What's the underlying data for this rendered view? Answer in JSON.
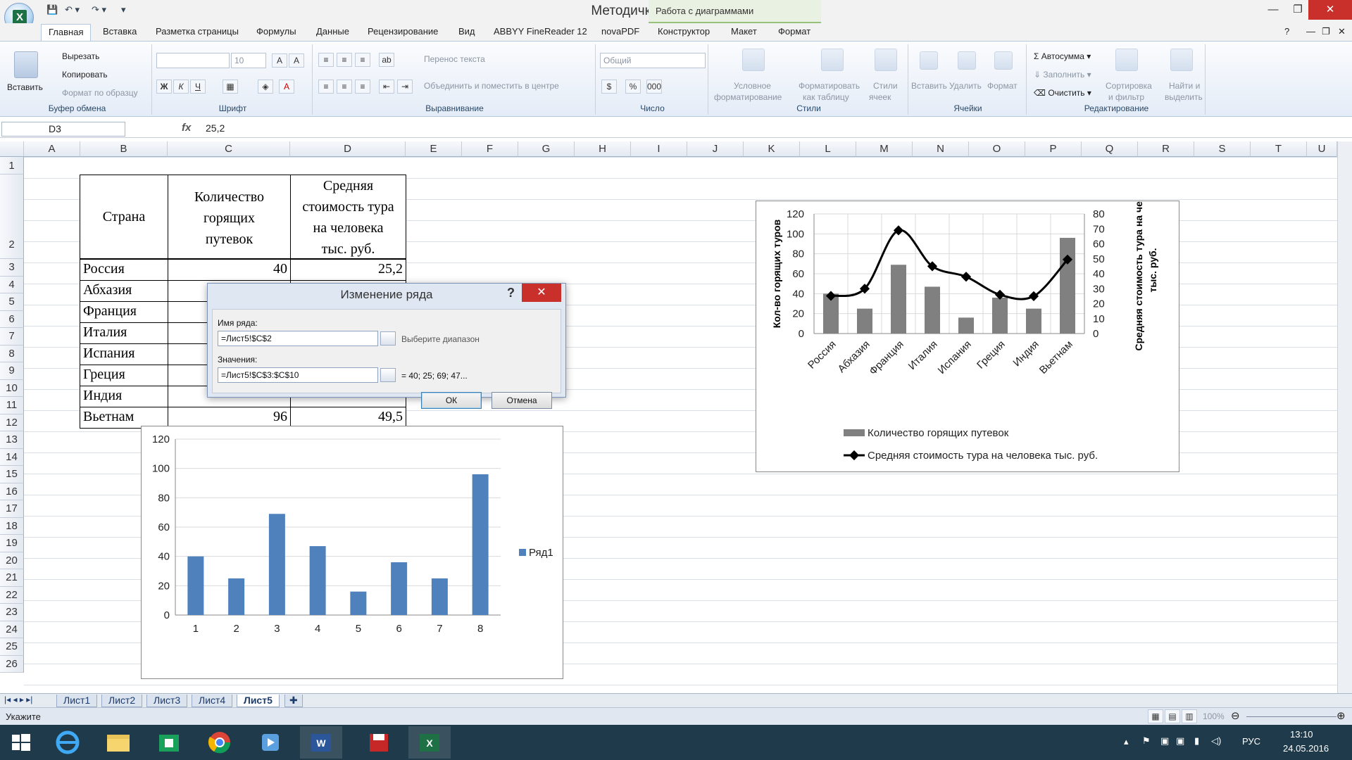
{
  "window": {
    "title": "Методичка - Microsoft Excel",
    "context_tab_group": "Работа с диаграммами"
  },
  "tabs": [
    {
      "label": "Главная",
      "active": true
    },
    {
      "label": "Вставка"
    },
    {
      "label": "Разметка страницы"
    },
    {
      "label": "Формулы"
    },
    {
      "label": "Данные"
    },
    {
      "label": "Рецензирование"
    },
    {
      "label": "Вид"
    },
    {
      "label": "ABBYY FineReader 12"
    },
    {
      "label": "novaPDF"
    },
    {
      "label": "Конструктор"
    },
    {
      "label": "Макет"
    },
    {
      "label": "Формат"
    }
  ],
  "ribbon": {
    "clipboard": {
      "paste": "Вставить",
      "cut": "Вырезать",
      "copy": "Копировать",
      "format_painter": "Формат по образцу",
      "label": "Буфер обмена"
    },
    "font": {
      "size": "10",
      "label": "Шрифт",
      "bold": "Ж",
      "italic": "К",
      "underline": "Ч"
    },
    "alignment": {
      "wrap": "Перенос текста",
      "merge": "Объединить и поместить в центре",
      "label": "Выравнивание"
    },
    "number": {
      "format": "Общий",
      "label": "Число"
    },
    "styles": {
      "conditional": "Условное",
      "conditional2": "форматирование",
      "as_table": "Форматировать",
      "as_table2": "как таблицу",
      "cell_styles": "Стили",
      "cell_styles2": "ячеек",
      "label": "Стили"
    },
    "cells": {
      "insert": "Вставить",
      "delete": "Удалить",
      "format": "Формат",
      "label": "Ячейки"
    },
    "editing": {
      "autosum": "Автосумма",
      "fill": "Заполнить",
      "clear": "Очистить",
      "sort": "Сортировка",
      "sort2": "и фильтр",
      "find": "Найти и",
      "find2": "выделить",
      "label": "Редактирование"
    }
  },
  "formula_bar": {
    "cell": "D3",
    "fx": "fx",
    "value": "25,2"
  },
  "columns": [
    "A",
    "B",
    "C",
    "D",
    "E",
    "F",
    "G",
    "H",
    "I",
    "J",
    "K",
    "L",
    "M",
    "N",
    "O",
    "P",
    "Q",
    "R",
    "S",
    "T",
    "U"
  ],
  "rows": [
    "1",
    "2",
    "3",
    "4",
    "5",
    "6",
    "7",
    "8",
    "9",
    "10",
    "11",
    "12",
    "13",
    "14",
    "15",
    "16",
    "17",
    "18",
    "19",
    "20",
    "21",
    "22",
    "23",
    "24",
    "25",
    "26"
  ],
  "table": {
    "header_country": "Страна",
    "header_count": [
      "Количество",
      "горящих",
      "путевок"
    ],
    "header_cost": [
      "Средняя",
      "стоимость тура",
      "на человека",
      "тыс. руб."
    ],
    "rows": [
      {
        "country": "Россия",
        "count": "40",
        "cost": "25,2"
      },
      {
        "country": "Абхазия",
        "count": "",
        "cost": ""
      },
      {
        "country": "Франция",
        "count": "",
        "cost": ""
      },
      {
        "country": "Италия",
        "count": "",
        "cost": ""
      },
      {
        "country": "Испания",
        "count": "",
        "cost": ""
      },
      {
        "country": "Греция",
        "count": "",
        "cost": ""
      },
      {
        "country": "Индия",
        "count": "",
        "cost": ""
      },
      {
        "country": "Вьетнам",
        "count": "96",
        "cost": "49,5"
      }
    ]
  },
  "dialog": {
    "title": "Изменение ряда",
    "help": "?",
    "close": "✕",
    "name_label": "Имя ряда:",
    "name_value": "=Лист5!$C$2",
    "name_hint": "Выберите диапазон",
    "values_label": "Значения:",
    "values_value": "=Лист5!$C$3:$C$10",
    "values_hint": "= 40; 25; 69; 47...",
    "ok": "ОК",
    "cancel": "Отмена"
  },
  "chart_data": [
    {
      "type": "bar",
      "categories": [
        "1",
        "2",
        "3",
        "4",
        "5",
        "6",
        "7",
        "8"
      ],
      "series": [
        {
          "name": "Ряд1",
          "values": [
            40,
            25,
            69,
            47,
            16,
            36,
            25,
            96
          ],
          "color": "#4f81bd"
        }
      ],
      "ylim": [
        0,
        120
      ],
      "yticks": [
        "0",
        "20",
        "40",
        "60",
        "80",
        "100",
        "120"
      ],
      "legend": "right"
    },
    {
      "type": "bar",
      "categories": [
        "Россия",
        "Абхазия",
        "Франция",
        "Италия",
        "Испания",
        "Греция",
        "Индия",
        "Вьетнам"
      ],
      "series": [
        {
          "name": "Количество горящих путевок",
          "values": [
            40,
            25,
            69,
            47,
            16,
            36,
            25,
            96
          ],
          "color": "#808080",
          "axis": "left"
        },
        {
          "name": "Средняя стоимость тура на человека тыс. руб.",
          "values": [
            25.2,
            30,
            69,
            45,
            38,
            26,
            25,
            49.5
          ],
          "color": "#000000",
          "axis": "right",
          "kind": "line"
        }
      ],
      "ylabel": "Кол-во горящих туров",
      "y2label": [
        "Средняя стоимость тура на чел.,",
        "тыс. руб."
      ],
      "ylim": [
        0,
        120
      ],
      "yticks": [
        "0",
        "20",
        "40",
        "60",
        "80",
        "100",
        "120"
      ],
      "y2lim": [
        0,
        80
      ],
      "y2ticks": [
        "0",
        "10",
        "20",
        "30",
        "40",
        "50",
        "60",
        "70",
        "80"
      ],
      "legend": "bottom"
    }
  ],
  "sheets": [
    {
      "label": "Лист1"
    },
    {
      "label": "Лист2"
    },
    {
      "label": "Лист3"
    },
    {
      "label": "Лист4"
    },
    {
      "label": "Лист5",
      "active": true
    }
  ],
  "status": {
    "mode": "Укажите",
    "zoom": "100%"
  },
  "taskbar": {
    "lang": "РУС",
    "time": "13:10",
    "date": "24.05.2016"
  }
}
